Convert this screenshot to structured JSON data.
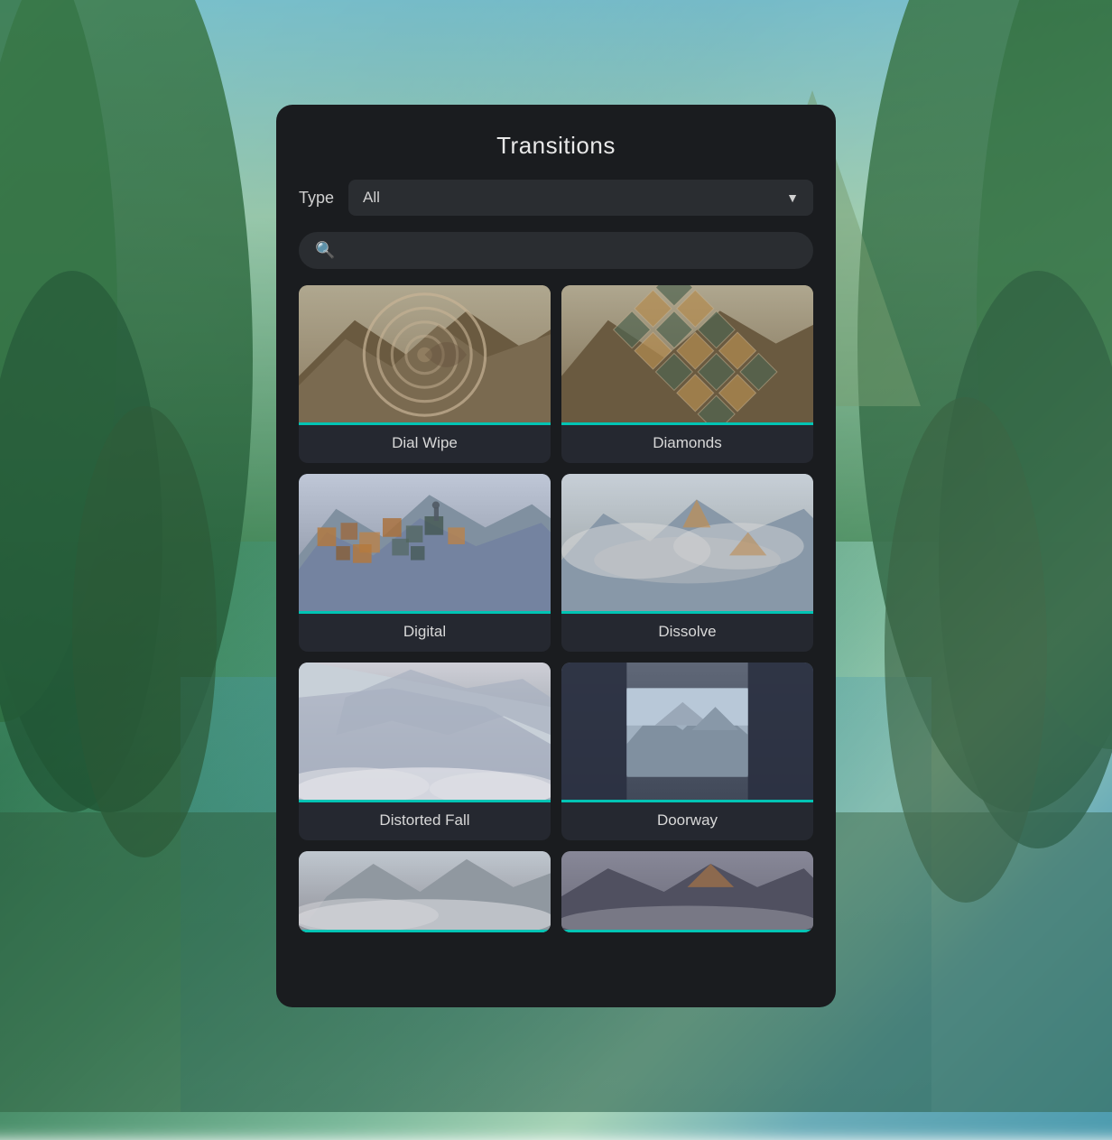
{
  "background": {
    "description": "blurred nature/forest background"
  },
  "panel": {
    "title": "Transitions",
    "type_label": "Type",
    "type_value": "All",
    "search_placeholder": "",
    "transitions": [
      {
        "id": "dial-wipe",
        "label": "Dial Wipe",
        "thumb_type": "dial-wipe"
      },
      {
        "id": "diamonds",
        "label": "Diamonds",
        "thumb_type": "diamonds"
      },
      {
        "id": "digital",
        "label": "Digital",
        "thumb_type": "digital"
      },
      {
        "id": "dissolve",
        "label": "Dissolve",
        "thumb_type": "dissolve"
      },
      {
        "id": "distorted-fall",
        "label": "Distorted Fall",
        "thumb_type": "distorted-fall"
      },
      {
        "id": "doorway",
        "label": "Doorway",
        "thumb_type": "doorway"
      },
      {
        "id": "partial-1",
        "label": "",
        "thumb_type": "partial-1"
      },
      {
        "id": "partial-2",
        "label": "",
        "thumb_type": "partial-2"
      }
    ]
  }
}
